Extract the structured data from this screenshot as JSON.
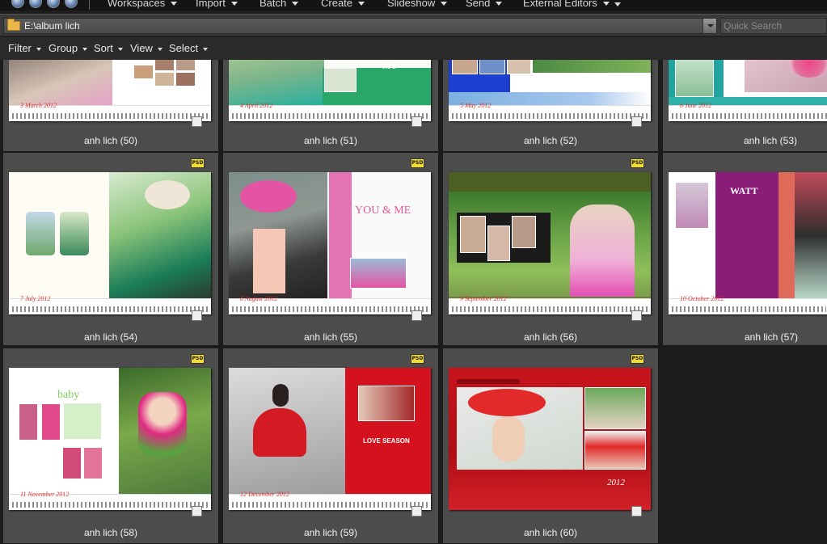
{
  "menubar": {
    "items": [
      "Workspaces",
      "Import",
      "Batch",
      "Create",
      "Slideshow",
      "Send",
      "External Editors"
    ]
  },
  "pathbar": {
    "path": "E:\\album lich",
    "search_placeholder": "Quick Search"
  },
  "toolbar": {
    "items": [
      "Filter",
      "Group",
      "Sort",
      "View",
      "Select"
    ]
  },
  "thumbnails": [
    {
      "caption": "anh lich (50)",
      "month": "3 March 2012",
      "badge": ""
    },
    {
      "caption": "anh lich (51)",
      "month": "4 April 2012",
      "badge": ""
    },
    {
      "caption": "anh lich (52)",
      "month": "5 May 2012",
      "badge": ""
    },
    {
      "caption": "anh lich (53)",
      "month": "6 June 2012",
      "badge": ""
    },
    {
      "caption": "anh lich (54)",
      "month": "7 July 2012",
      "badge": "PSD"
    },
    {
      "caption": "anh lich (55)",
      "month": "8 August 2012",
      "badge": "PSD"
    },
    {
      "caption": "anh lich (56)",
      "month": "9 September 2012",
      "badge": "PSD"
    },
    {
      "caption": "anh lich (57)",
      "month": "10 October 2012",
      "badge": "PSD"
    },
    {
      "caption": "anh lich (58)",
      "month": "11 November 2012",
      "badge": "PSD"
    },
    {
      "caption": "anh lich (59)",
      "month": "12 December 2012",
      "badge": "PSD"
    },
    {
      "caption": "anh lich (60)",
      "month": "",
      "badge": "PSD"
    }
  ],
  "decor": {
    "t51": "MY",
    "t55": "YOU & ME",
    "t57": "WATT",
    "t58": "baby",
    "t59": "LOVE SEASON",
    "t60": "2012"
  },
  "colors": {
    "accent_green": "#2aa86a",
    "accent_blue": "#1d3fcf",
    "accent_pink": "#e574b5",
    "accent_purple": "#8a1d78",
    "accent_red": "#d3121e"
  }
}
